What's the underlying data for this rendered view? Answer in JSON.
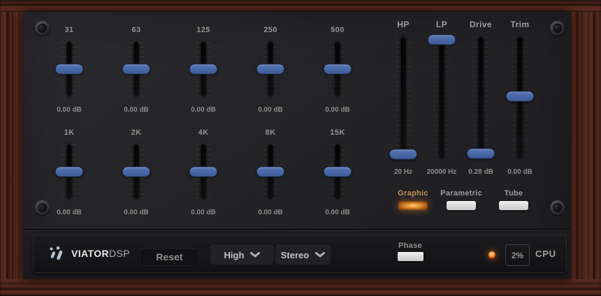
{
  "eq_bands": [
    {
      "label": "31",
      "value": "0.00 dB",
      "thumb_pct": 50
    },
    {
      "label": "63",
      "value": "0.00 dB",
      "thumb_pct": 50
    },
    {
      "label": "125",
      "value": "0.00 dB",
      "thumb_pct": 50
    },
    {
      "label": "250",
      "value": "0.00 dB",
      "thumb_pct": 50
    },
    {
      "label": "500",
      "value": "0.00 dB",
      "thumb_pct": 50
    },
    {
      "label": "1K",
      "value": "0.00 dB",
      "thumb_pct": 50
    },
    {
      "label": "2K",
      "value": "0.00 dB",
      "thumb_pct": 50
    },
    {
      "label": "4K",
      "value": "0.00 dB",
      "thumb_pct": 50
    },
    {
      "label": "8K",
      "value": "0.00 dB",
      "thumb_pct": 50
    },
    {
      "label": "15K",
      "value": "0.00 dB",
      "thumb_pct": 50
    }
  ],
  "filters": [
    {
      "label": "HP",
      "value": "20 Hz",
      "thumb_pct": 96.5
    },
    {
      "label": "LP",
      "value": "20000 Hz",
      "thumb_pct": 2.3
    },
    {
      "label": "Drive",
      "value": "0.28 dB",
      "thumb_pct": 96.0
    },
    {
      "label": "Trim",
      "value": "0.00 dB",
      "thumb_pct": 48.9
    }
  ],
  "modes": [
    {
      "label": "Graphic",
      "state": "on"
    },
    {
      "label": "Parametric",
      "state": "off"
    },
    {
      "label": "Tube",
      "state": "off"
    }
  ],
  "footer": {
    "brand_bold": "VIATOR",
    "brand_light": "DSP",
    "reset_label": "Reset",
    "quality_value": "High",
    "channel_value": "Stereo",
    "phase_label": "Phase",
    "cpu_value": "2%",
    "cpu_label": "CPU"
  },
  "colors": {
    "thumb_blue": "#4a69a6",
    "active_amber": "#c6955b",
    "lit_button_orange": "#ec9a3c",
    "led_orange": "#ff7a1f",
    "wood_brown": "#4a231a",
    "panel_gray": "#232326"
  }
}
